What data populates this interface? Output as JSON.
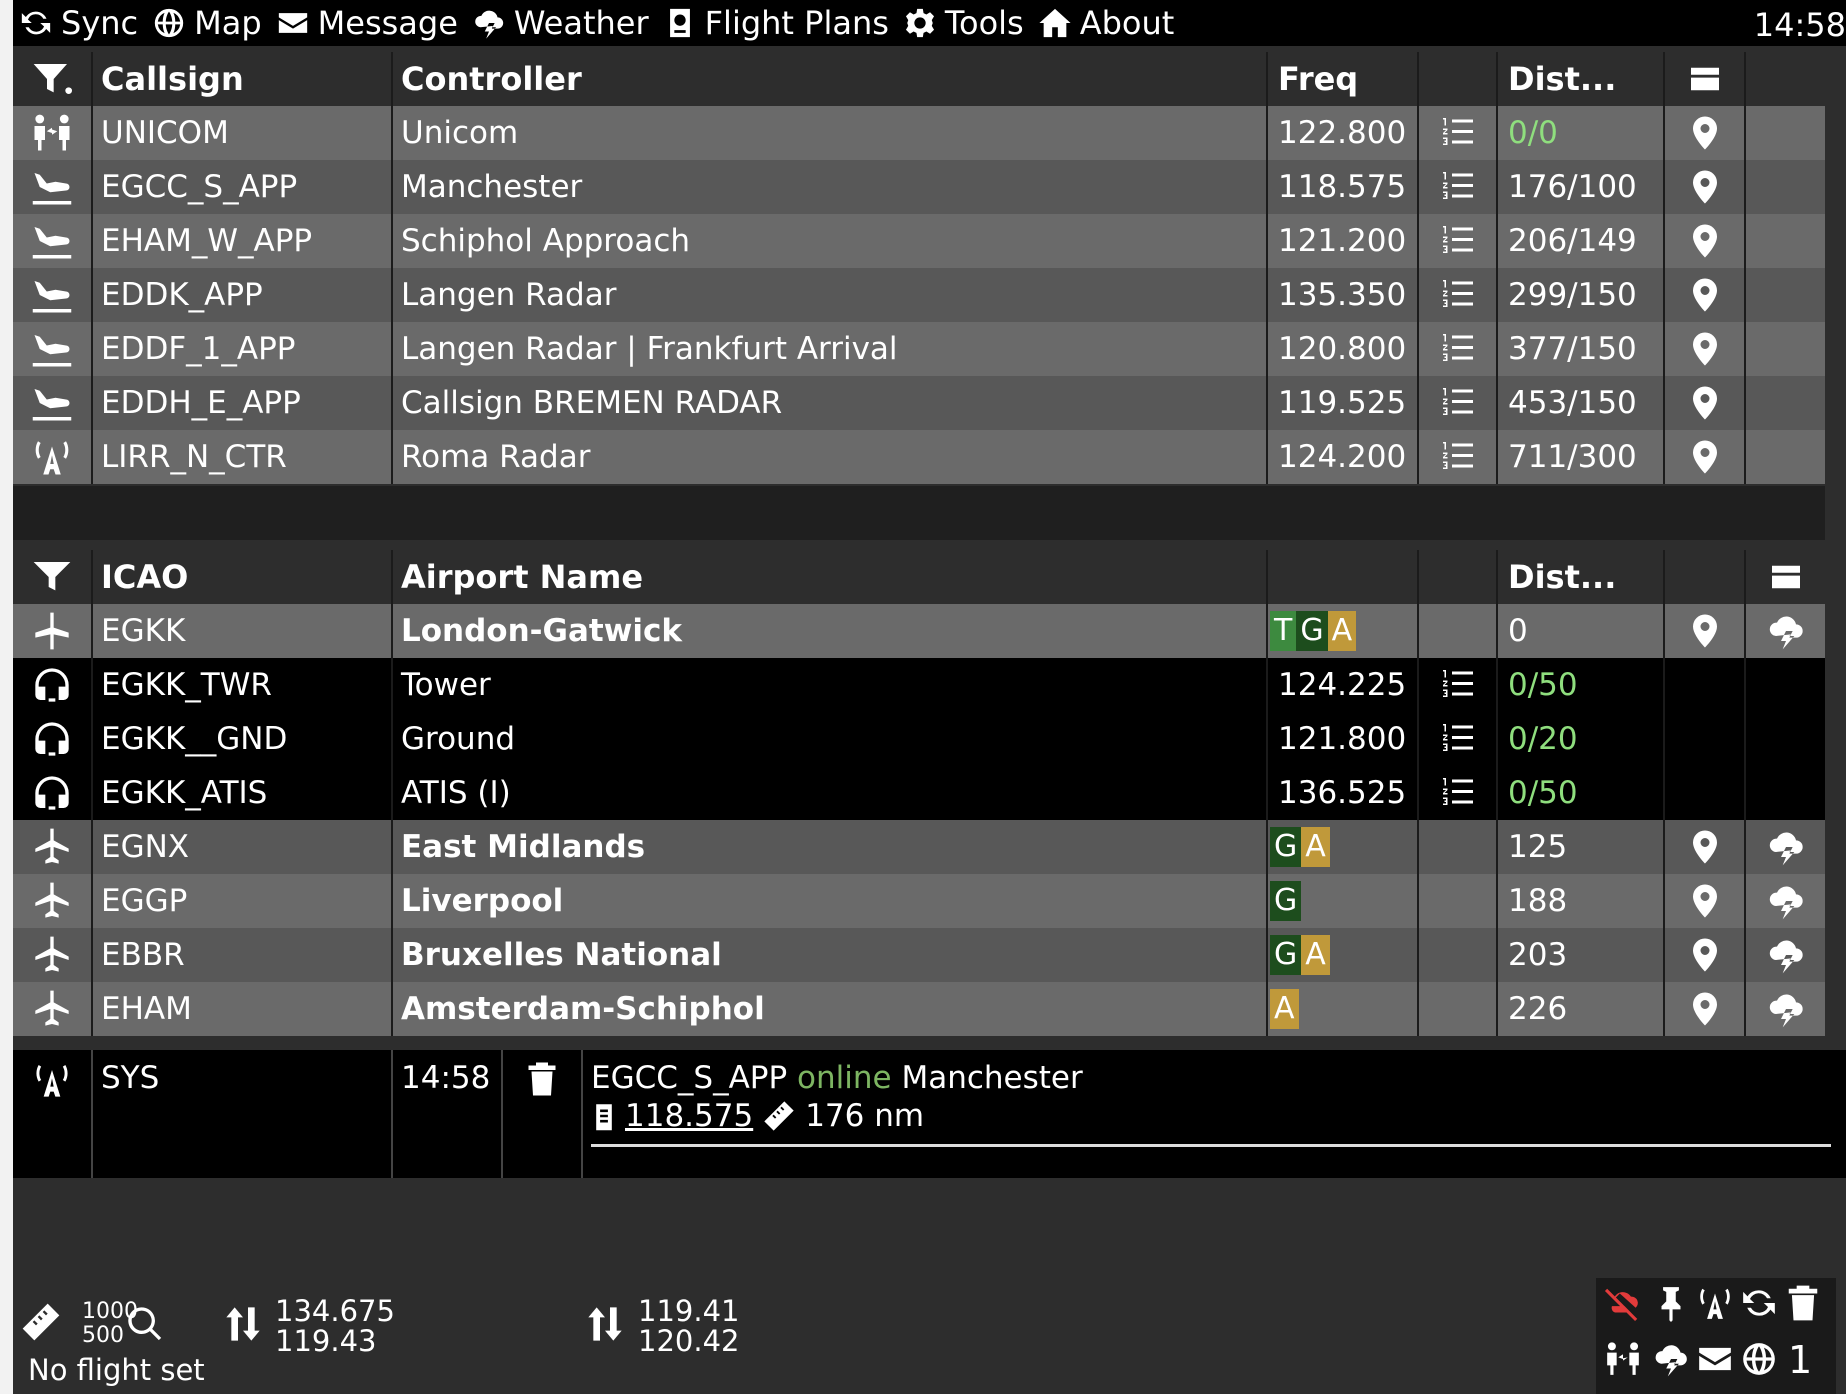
{
  "menu": {
    "items": [
      {
        "label": "Sync",
        "icon": "sync-icon"
      },
      {
        "label": "Map",
        "icon": "globe-icon"
      },
      {
        "label": "Message",
        "icon": "envelope-icon"
      },
      {
        "label": "Weather",
        "icon": "weather-icon"
      },
      {
        "label": "Flight Plans",
        "icon": "passport-icon"
      },
      {
        "label": "Tools",
        "icon": "gear-icon"
      },
      {
        "label": "About",
        "icon": "home-icon"
      }
    ],
    "clock": "14:58"
  },
  "controllers": {
    "headers": {
      "callsign": "Callsign",
      "controller": "Controller",
      "freq": "Freq",
      "dist": "Dist..."
    },
    "rows": [
      {
        "callsign": "UNICOM",
        "name": "Unicom",
        "freq": "122.800",
        "dist": "0/0",
        "icon": "unicom-icon",
        "dist_color": "#8fde7e"
      },
      {
        "callsign": "EGCC_S_APP",
        "name": "Manchester",
        "freq": "118.575",
        "dist": "176/100",
        "icon": "approach-icon"
      },
      {
        "callsign": "EHAM_W_APP",
        "name": "Schiphol Approach",
        "freq": "121.200",
        "dist": "206/149",
        "icon": "approach-icon"
      },
      {
        "callsign": "EDDK_APP",
        "name": "Langen Radar",
        "freq": "135.350",
        "dist": "299/150",
        "icon": "approach-icon"
      },
      {
        "callsign": "EDDF_1_APP",
        "name": "Langen Radar | Frankfurt Arrival",
        "freq": "120.800",
        "dist": "377/150",
        "icon": "approach-icon"
      },
      {
        "callsign": "EDDH_E_APP",
        "name": "Callsign BREMEN RADAR",
        "freq": "119.525",
        "dist": "453/150",
        "icon": "approach-icon"
      },
      {
        "callsign": "LIRR_N_CTR",
        "name": "Roma Radar",
        "freq": "124.200",
        "dist": "711/300",
        "icon": "center-antenna-icon"
      }
    ]
  },
  "airports": {
    "headers": {
      "icao": "ICAO",
      "name": "Airport Name",
      "dist": "Dist..."
    },
    "rows": [
      {
        "type": "airport",
        "icao": "EGKK",
        "name": "London-Gatwick",
        "badges": [
          "T",
          "G",
          "A"
        ],
        "dist": "0"
      },
      {
        "type": "atc",
        "icao": "EGKK_TWR",
        "name": "Tower",
        "freq": "124.225",
        "dist": "0/50"
      },
      {
        "type": "atc",
        "icao": "EGKK__GND",
        "name": "Ground",
        "freq": "121.800",
        "dist": "0/20"
      },
      {
        "type": "atc",
        "icao": "EGKK_ATIS",
        "name": "ATIS (I)",
        "freq": "136.525",
        "dist": "0/50"
      },
      {
        "type": "airport",
        "icao": "EGNX",
        "name": "East Midlands",
        "badges": [
          "G",
          "A"
        ],
        "dist": "125"
      },
      {
        "type": "airport",
        "icao": "EGGP",
        "name": "Liverpool",
        "badges": [
          "G"
        ],
        "dist": "188"
      },
      {
        "type": "airport",
        "icao": "EBBR",
        "name": "Bruxelles National",
        "badges": [
          "G",
          "A"
        ],
        "dist": "203"
      },
      {
        "type": "airport",
        "icao": "EHAM",
        "name": "Amsterdam-Schiphol",
        "badges": [
          "A"
        ],
        "dist": "226"
      }
    ],
    "badge_colors": {
      "T": "#3d8a3f",
      "G": "#1d4d1d",
      "A": "#c0993a"
    }
  },
  "message": {
    "sender": "SYS",
    "time": "14:58",
    "callsign": "EGCC_S_APP",
    "status": "online",
    "station": "Manchester",
    "freq": "118.575",
    "distance": "176 nm"
  },
  "status": {
    "range_top": "1000",
    "range_bottom": "500",
    "flight": "No flight set",
    "com1_active": "134.675",
    "com1_standby": "119.43",
    "com2_active": "119.41",
    "com2_standby": "120.42",
    "count": "1"
  }
}
